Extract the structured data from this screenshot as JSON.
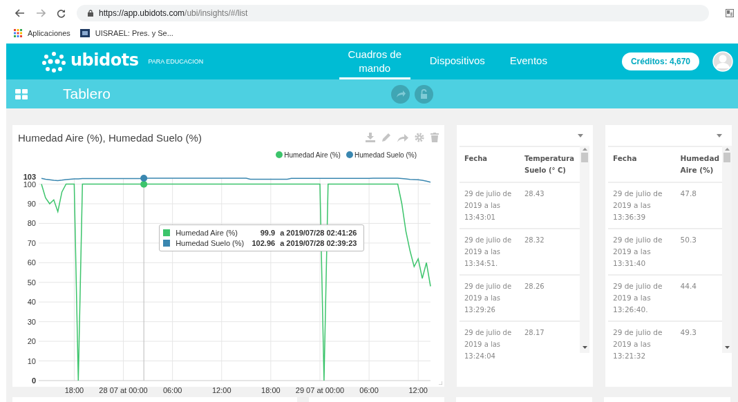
{
  "browser": {
    "url_host": "https://app.ubidots.com",
    "url_path": "/ubi/insights/#/list",
    "bookmarks": [
      {
        "label": "Aplicaciones",
        "kind": "apps"
      },
      {
        "label": "UISRAEL: Pres. y Se...",
        "kind": "site"
      }
    ]
  },
  "header": {
    "logo": "ubidots",
    "tagline": "PARA EDUCACION",
    "nav": [
      {
        "label": "Cuadros de mando",
        "selected": true
      },
      {
        "label": "Dispositivos",
        "selected": false
      },
      {
        "label": "Eventos",
        "selected": false
      }
    ],
    "credits": "Créditos: 4,670"
  },
  "toolbar": {
    "title": "Tablero"
  },
  "chart_widget": {
    "title": "Humedad Aire (%), Humedad Suelo (%)",
    "chart_data": {
      "type": "line",
      "categories": [
        null,
        null,
        null,
        null,
        null,
        null,
        null,
        null,
        "18:00",
        null,
        null,
        null,
        null,
        null,
        null,
        null,
        null,
        null,
        null,
        null,
        "28 07 at 00:00",
        null,
        null,
        null,
        null,
        null,
        null,
        null,
        null,
        null,
        null,
        null,
        "06:00",
        null,
        null,
        null,
        null,
        null,
        null,
        null,
        null,
        null,
        null,
        null,
        "12:00",
        null,
        null,
        null,
        null,
        null,
        null,
        null,
        null,
        null,
        null,
        null,
        "18:00",
        null,
        null,
        null,
        null,
        null,
        null,
        null,
        null,
        null,
        null,
        null,
        "29 07 at 00:00",
        null,
        null,
        null,
        null,
        null,
        null,
        null,
        null,
        null,
        null,
        null,
        "06:00",
        null,
        null,
        null,
        null,
        null,
        null,
        null,
        null,
        null,
        null,
        null,
        "12:00",
        null,
        null,
        null
      ],
      "series": [
        {
          "name": "Humedad Aire (%)",
          "color": "#3cc46b",
          "values": [
            100,
            93,
            90,
            92,
            86,
            96,
            100,
            100,
            100,
            0,
            100,
            100,
            100,
            100,
            100,
            100,
            100,
            100,
            100,
            100,
            100,
            100,
            100,
            100,
            100,
            99.9,
            100,
            100,
            100,
            100,
            100,
            100,
            100,
            100,
            100,
            100,
            100,
            100,
            100,
            100,
            100,
            100,
            100,
            100,
            100,
            100,
            100,
            100,
            100,
            100,
            100,
            100,
            100,
            100,
            100,
            100,
            100,
            100,
            100,
            100,
            100,
            100,
            100,
            100,
            100,
            100,
            100,
            100,
            100,
            0,
            100,
            100,
            100,
            100,
            100,
            100,
            100,
            100,
            100,
            100,
            100,
            100,
            100,
            100,
            100,
            100,
            100,
            100,
            90,
            76,
            66,
            58,
            62,
            52,
            60,
            48
          ]
        },
        {
          "name": "Humedad Suelo (%)",
          "color": "#3a87b0",
          "values": [
            102.9,
            102.5,
            102.2,
            101.9,
            101.8,
            102.0,
            102.3,
            102.5,
            102.6,
            102.7,
            102.8,
            102.8,
            102.8,
            102.8,
            102.8,
            102.8,
            102.8,
            102.8,
            102.8,
            102.8,
            102.8,
            102.8,
            102.8,
            102.8,
            102.8,
            103,
            103,
            103,
            103,
            103,
            103,
            103,
            103,
            103,
            103,
            103,
            103,
            103,
            103,
            103,
            103,
            103,
            103,
            103,
            103,
            103,
            103,
            103,
            103,
            103,
            103,
            102.5,
            102.5,
            102.5,
            102.5,
            102.5,
            102.5,
            102.5,
            102.5,
            102.5,
            102.5,
            102.9,
            102.9,
            102.9,
            102.9,
            102.9,
            102.9,
            102.9,
            102.9,
            102.9,
            102.9,
            102.9,
            102.9,
            102.9,
            102.9,
            102.9,
            102.9,
            102.9,
            102.9,
            102.9,
            102.9,
            103,
            103,
            103,
            103,
            103,
            103,
            103,
            102.8,
            102.6,
            102.4,
            102.3,
            102.2,
            101.9,
            101.5,
            101.0
          ]
        }
      ],
      "ylim": [
        0,
        103
      ],
      "grid": true,
      "legend": "top",
      "yticks": [
        0,
        10,
        20,
        30,
        40,
        50,
        60,
        70,
        80,
        90,
        100,
        103
      ]
    },
    "tooltip": {
      "rows": [
        {
          "name": "Humedad Aire (%)",
          "color": "#3cc46b",
          "value": "99.9",
          "time": "a 2019/07/28 02:41:26"
        },
        {
          "name": "Humedad Suelo (%)",
          "color": "#3a87b0",
          "value": "102.96",
          "time": "a 2019/07/28 02:39:23"
        }
      ]
    }
  },
  "table_widgets": [
    {
      "columns": [
        "Fecha",
        "Temperatura Suelo (° C)"
      ],
      "rows": [
        [
          "29 de julio de 2019 a las 13:43:01",
          "28.43"
        ],
        [
          "29 de julio de 2019 a las 13:34:51.",
          "28.32"
        ],
        [
          "29 de julio de 2019 a las 13:29:26",
          "28.26"
        ],
        [
          "29 de julio de 2019 a las 13:24:04",
          "28.17"
        ]
      ]
    },
    {
      "columns": [
        "Fecha",
        "Humedad Aire (%)"
      ],
      "rows": [
        [
          "29 de julio de 2019 a las 13:36:39",
          "47.8"
        ],
        [
          "29 de julio de 2019 a las 13:31:40",
          "50.3"
        ],
        [
          "29 de julio de 2019 a las 13:26:40.",
          "44.4"
        ],
        [
          "29 de julio de 2019 a las 13:21:32",
          "49.3"
        ]
      ]
    }
  ]
}
